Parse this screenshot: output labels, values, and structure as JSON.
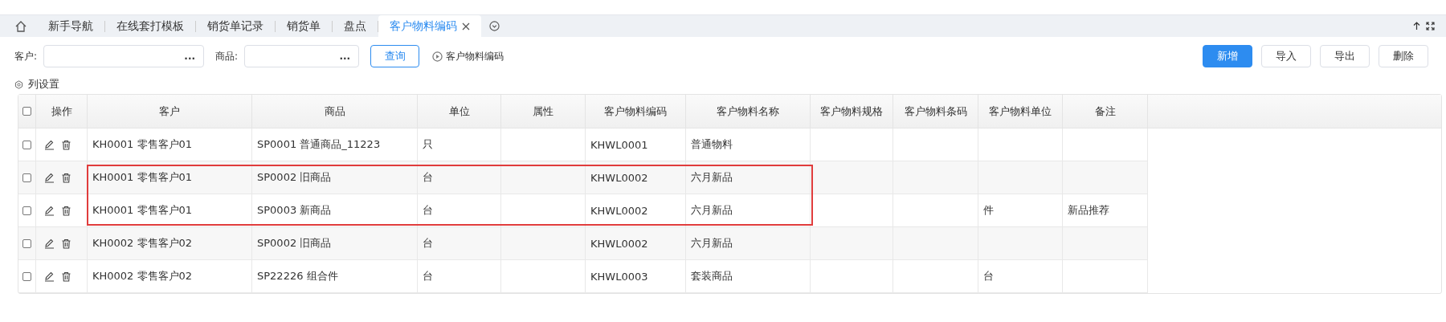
{
  "tabs": [
    {
      "label": "新手导航",
      "selected": false,
      "closable": false
    },
    {
      "label": "在线套打模板",
      "selected": false,
      "closable": false
    },
    {
      "label": "销货单记录",
      "selected": false,
      "closable": false
    },
    {
      "label": "销货单",
      "selected": false,
      "closable": false
    },
    {
      "label": "盘点",
      "selected": false,
      "closable": false
    },
    {
      "label": "客户物料编码",
      "selected": true,
      "closable": true
    }
  ],
  "filters": [
    {
      "label": "客户:",
      "ellipsis": "..."
    },
    {
      "label": "商品:",
      "ellipsis": "..."
    }
  ],
  "search_button": "查询",
  "code_link": "客户物料编码",
  "actions": [
    {
      "label": "新增",
      "kind": "primary"
    },
    {
      "label": "导入",
      "kind": "default"
    },
    {
      "label": "导出",
      "kind": "default"
    },
    {
      "label": "删除",
      "kind": "default"
    }
  ],
  "column_settings": "列设置",
  "table": {
    "select_all_checked": false,
    "ops_header": "操作",
    "columns": [
      "客户",
      "商品",
      "单位",
      "属性",
      "客户物料编码",
      "客户物料名称",
      "客户物料规格",
      "客户物料条码",
      "客户物料单位",
      "备注"
    ],
    "rows": [
      {
        "checked": false,
        "highlighted": false,
        "cells": [
          "KH0001 零售客户01",
          "SP0001 普通商品_11223",
          "只",
          null,
          "KHWL0001",
          "普通物料",
          null,
          null,
          null,
          null
        ]
      },
      {
        "checked": false,
        "highlighted": true,
        "cells": [
          "KH0001 零售客户01",
          "SP0002 旧商品",
          "台",
          null,
          "KHWL0002",
          "六月新品",
          null,
          null,
          null,
          null
        ]
      },
      {
        "checked": false,
        "highlighted": true,
        "cells": [
          "KH0001 零售客户01",
          "SP0003 新商品",
          "台",
          null,
          "KHWL0002",
          "六月新品",
          null,
          null,
          "件",
          "新品推荐"
        ]
      },
      {
        "checked": false,
        "highlighted": false,
        "cells": [
          "KH0002 零售客户02",
          "SP0002 旧商品",
          "台",
          null,
          "KHWL0002",
          "六月新品",
          null,
          null,
          null,
          null
        ]
      },
      {
        "checked": false,
        "highlighted": false,
        "cells": [
          "KH0002 零售客户02",
          "SP22226 组合件",
          "台",
          null,
          "KHWL0003",
          "套装商品",
          null,
          null,
          "台",
          null
        ]
      }
    ]
  }
}
